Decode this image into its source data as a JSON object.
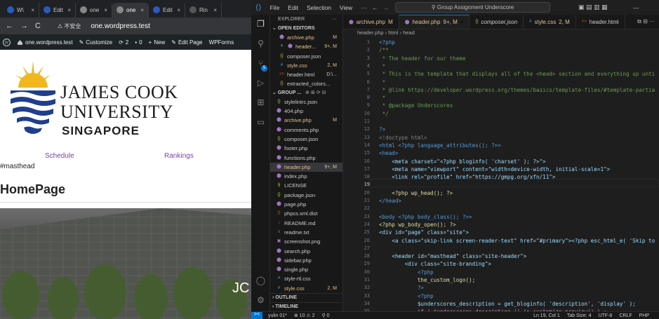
{
  "browser": {
    "tabs": [
      {
        "label": "W\\",
        "color": "#2a5cbf"
      },
      {
        "label": "Edit",
        "color": "#2a5cbf"
      },
      {
        "label": "one",
        "color": "#888888"
      },
      {
        "label": "one",
        "color": "#888888",
        "active": true
      },
      {
        "label": "Edit",
        "color": "#2a5cbf"
      },
      {
        "label": "Rin",
        "color": "#555555"
      }
    ],
    "close": "×",
    "back": "←",
    "forward": "→",
    "reload": "C",
    "security": "⚠ 不安全",
    "url": "one.wordpress.test"
  },
  "wp_admin_bar": {
    "site": "one.wordpress.test",
    "customize": "Customize",
    "updates": "2",
    "comments": "0",
    "new": "New",
    "edit_page": "Edit Page",
    "wpforms": "WPForms"
  },
  "page": {
    "logo_line1": "JAMES COOK",
    "logo_line2": "UNIVERSITY",
    "logo_line3": "SINGAPORE",
    "nav": [
      "Schedule",
      "Rankings"
    ],
    "masthead_text": "#masthead",
    "heading": "HomePage",
    "hero_text": "JC",
    "link_color": "#7b3fa0"
  },
  "vscode": {
    "menu": [
      "File",
      "Edit",
      "Selection",
      "View",
      "···"
    ],
    "search_placeholder": "Group Assignment Underscore",
    "explorer_title": "EXPLORER",
    "open_editors_title": "OPEN EDITORS",
    "open_editors": [
      {
        "name": "archive.php",
        "badge": "M",
        "icon": "php",
        "color": "#e2c08d"
      },
      {
        "name": "header...",
        "badge": "9+, M",
        "icon": "php",
        "color": "#e2c08d",
        "close": true
      },
      {
        "name": "composer.json",
        "badge": "",
        "icon": "json",
        "color": "#cccccc"
      },
      {
        "name": "style.css",
        "badge": "2, M",
        "icon": "css",
        "color": "#e2c08d"
      },
      {
        "name": "header.html",
        "badge": "D:\\...",
        "icon": "html",
        "color": "#cccccc"
      },
      {
        "name": "extracted_colors...",
        "badge": "",
        "icon": "json",
        "color": "#cccccc"
      }
    ],
    "group_title": "GROUP ...",
    "files": [
      {
        "name": "stylelintrc.json",
        "badge": "",
        "icon": "json",
        "color": "#cccccc"
      },
      {
        "name": "404.php",
        "badge": "",
        "icon": "php",
        "color": "#cccccc"
      },
      {
        "name": "archive.php",
        "badge": "M",
        "icon": "php",
        "color": "#e2c08d"
      },
      {
        "name": "comments.php",
        "badge": "",
        "icon": "php",
        "color": "#cccccc"
      },
      {
        "name": "composer.json",
        "badge": "",
        "icon": "json",
        "color": "#cccccc"
      },
      {
        "name": "footer.php",
        "badge": "",
        "icon": "php",
        "color": "#cccccc"
      },
      {
        "name": "functions.php",
        "badge": "",
        "icon": "php",
        "color": "#cccccc"
      },
      {
        "name": "header.php",
        "badge": "9+, M",
        "icon": "php",
        "color": "#e2c08d",
        "selected": true
      },
      {
        "name": "index.php",
        "badge": "",
        "icon": "php",
        "color": "#cccccc"
      },
      {
        "name": "LICENSE",
        "badge": "",
        "icon": "license",
        "color": "#cccccc"
      },
      {
        "name": "package.json",
        "badge": "",
        "icon": "json",
        "color": "#cccccc"
      },
      {
        "name": "page.php",
        "badge": "",
        "icon": "php",
        "color": "#cccccc"
      },
      {
        "name": "phpcs.xml.dist",
        "badge": "",
        "icon": "xml",
        "color": "#cccccc"
      },
      {
        "name": "README.md",
        "badge": "",
        "icon": "md",
        "color": "#cccccc"
      },
      {
        "name": "readme.txt",
        "badge": "",
        "icon": "txt",
        "color": "#cccccc"
      },
      {
        "name": "screenshot.png",
        "badge": "",
        "icon": "img",
        "color": "#cccccc"
      },
      {
        "name": "search.php",
        "badge": "",
        "icon": "php",
        "color": "#cccccc"
      },
      {
        "name": "sidebar.php",
        "badge": "",
        "icon": "php",
        "color": "#cccccc"
      },
      {
        "name": "single.php",
        "badge": "",
        "icon": "php",
        "color": "#cccccc"
      },
      {
        "name": "style-rtl.css",
        "badge": "",
        "icon": "css",
        "color": "#cccccc"
      },
      {
        "name": "style.css",
        "badge": "2, M",
        "icon": "css",
        "color": "#e2c08d"
      }
    ],
    "outline_title": "OUTLINE",
    "timeline_title": "TIMELINE",
    "editor_tabs": [
      {
        "name": "archive.php",
        "badge": "M",
        "color": "#e2c08d"
      },
      {
        "name": "header.php",
        "badge": "9+, M",
        "color": "#e2c08d",
        "active": true
      },
      {
        "name": "composer.json",
        "badge": "",
        "color": "#cccccc",
        "italic": true
      },
      {
        "name": "style.css",
        "badge": "2, M",
        "color": "#e2c08d"
      },
      {
        "name": "header.html",
        "badge": "",
        "color": "#cccccc"
      }
    ],
    "breadcrumb": [
      "header.php",
      "html",
      "head"
    ],
    "code_lines": [
      {
        "n": "1",
        "t": "<?php",
        "c": "#569cd6"
      },
      {
        "n": "2",
        "t": "/**",
        "c": "#6a9955"
      },
      {
        "n": "3",
        "t": " * The header for our theme",
        "c": "#6a9955"
      },
      {
        "n": "4",
        "t": " *",
        "c": "#6a9955"
      },
      {
        "n": "5",
        "t": " * This is the template that displays all of the <head> section and everything up unti",
        "c": "#6a9955"
      },
      {
        "n": "6",
        "t": " *",
        "c": "#6a9955"
      },
      {
        "n": "7",
        "t": " * @link https://developer.wordpress.org/themes/basics/template-files/#template-partia",
        "c": "#6a9955"
      },
      {
        "n": "8",
        "t": " *",
        "c": "#6a9955"
      },
      {
        "n": "9",
        "t": " * @package Underscores",
        "c": "#6a9955"
      },
      {
        "n": "10",
        "t": " */",
        "c": "#6a9955"
      },
      {
        "n": "11",
        "t": "",
        "c": "#d4d4d4"
      },
      {
        "n": "12",
        "t": "?>",
        "c": "#569cd6"
      },
      {
        "n": "13",
        "t": "<!doctype html>",
        "c": "#808080"
      },
      {
        "n": "14",
        "t": "<html <?php language_attributes(); ?>>",
        "c": "#569cd6"
      },
      {
        "n": "15",
        "t": "<head>",
        "c": "#569cd6"
      },
      {
        "n": "16",
        "t": "    <meta charset=\"<?php bloginfo( 'charset' ); ?>\">",
        "c": "#9cdcfe"
      },
      {
        "n": "17",
        "t": "    <meta name=\"viewport\" content=\"width=device-width, initial-scale=1\">",
        "c": "#9cdcfe"
      },
      {
        "n": "18",
        "t": "    <link rel=\"profile\" href=\"https://gmpg.org/xfn/11\">",
        "c": "#9cdcfe"
      },
      {
        "n": "19",
        "t": "",
        "c": "#d4d4d4"
      },
      {
        "n": "20",
        "t": "    <?php wp_head(); ?>",
        "c": "#dcdcaa"
      },
      {
        "n": "21",
        "t": "</head>",
        "c": "#569cd6"
      },
      {
        "n": "22",
        "t": "",
        "c": "#d4d4d4"
      },
      {
        "n": "23",
        "t": "<body <?php body_class(); ?>>",
        "c": "#569cd6"
      },
      {
        "n": "24",
        "t": "<?php wp_body_open(); ?>",
        "c": "#dcdcaa"
      },
      {
        "n": "25",
        "t": "<div id=\"page\" class=\"site\">",
        "c": "#9cdcfe"
      },
      {
        "n": "26",
        "t": "    <a class=\"skip-link screen-reader-text\" href=\"#primary\"><?php esc_html_e( 'Skip to",
        "c": "#9cdcfe"
      },
      {
        "n": "27",
        "t": "",
        "c": "#d4d4d4"
      },
      {
        "n": "28",
        "t": "    <header id=\"masthead\" class=\"site-header\">",
        "c": "#9cdcfe"
      },
      {
        "n": "29",
        "t": "        <div class=\"site-branding\">",
        "c": "#9cdcfe"
      },
      {
        "n": "30",
        "t": "            <?php",
        "c": "#569cd6"
      },
      {
        "n": "31",
        "t": "            the_custom_logo();",
        "c": "#dcdcaa"
      },
      {
        "n": "32",
        "t": "            ?>",
        "c": "#569cd6"
      },
      {
        "n": "33",
        "t": "            <?php",
        "c": "#569cd6"
      },
      {
        "n": "34",
        "t": "            $underscores_description = get_bloginfo( 'description', 'display' );",
        "c": "#9cdcfe"
      },
      {
        "n": "35",
        "t": "            if ( $underscores_description || is_customize_preview() ) :",
        "c": "#c586c0"
      }
    ],
    "status": {
      "remote": "><",
      "branch": "yulin 01*",
      "problems": "⊗ 10 ⚠ 2",
      "ports": "⚲ 0",
      "position": "Ln 19, Col 1",
      "tab_size": "Tab Size: 4",
      "encoding": "UTF-8",
      "eol": "CRLF",
      "language": "PHP"
    }
  }
}
